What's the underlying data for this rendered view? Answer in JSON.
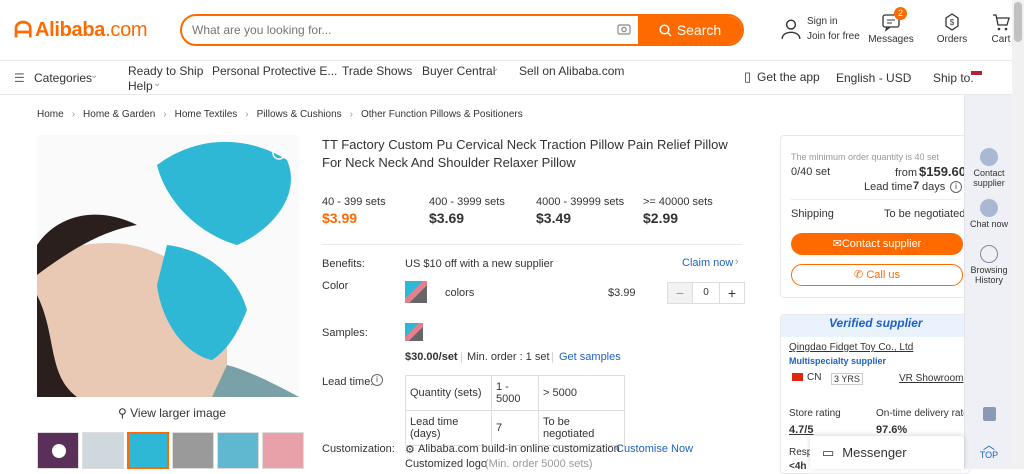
{
  "header": {
    "logo_text": "Alibaba",
    "logo_suffix": ".com",
    "search_placeholder": "What are you looking for...",
    "search_button": "Search",
    "sign_in": "Sign in",
    "join": "Join for free",
    "messages": "Messages",
    "messages_badge": "2",
    "orders": "Orders",
    "cart": "Cart"
  },
  "nav": {
    "categories": "Categories",
    "ready_to_ship": "Ready to Ship",
    "ppe": "Personal Protective E...",
    "trade_shows": "Trade Shows",
    "buyer_central": "Buyer Central",
    "sell": "Sell on Alibaba.com",
    "help": "Help",
    "get_app": "Get the app",
    "language": "English - USD",
    "ship_to": "Ship to:"
  },
  "breadcrumb": [
    "Home",
    "Home & Garden",
    "Home Textiles",
    "Pillows & Cushions",
    "Other Function Pillows & Positioners"
  ],
  "product": {
    "title": "TT Factory Custom Pu Cervical Neck Traction Pillow Pain Relief Pillow For Neck Neck And Shoulder Relaxer Pillow",
    "view_larger": "View larger image",
    "tiers": [
      {
        "qty": "40 - 399 sets",
        "price": "$3.99"
      },
      {
        "qty": "400 - 3999 sets",
        "price": "$3.69"
      },
      {
        "qty": "4000 - 39999 sets",
        "price": "$3.49"
      },
      {
        "qty": ">= 40000 sets",
        "price": "$2.99"
      }
    ],
    "benefits_label": "Benefits:",
    "benefits_text": "US $10 off with a new supplier",
    "claim_now": "Claim now",
    "color_label": "Color",
    "color_name": "colors",
    "color_price": "$3.99",
    "qty_value": "0",
    "samples_label": "Samples:",
    "sample_price": "$30.00/set",
    "sample_min": "Min. order : 1 set",
    "get_samples": "Get samples",
    "lead_label": "Lead time:",
    "lead_table": {
      "h1": "Quantity (sets)",
      "h2": "1 - 5000",
      "h3": "> 5000",
      "r1": "Lead time (days)",
      "r2": "7",
      "r3": "To be negotiated"
    },
    "custom_label": "Customization:",
    "custom_text": "Alibaba.com build-in online customization",
    "customise_now": "Customise Now",
    "custom_logo": "Customized logo",
    "custom_logo_min": "(Min. order 5000 sets)"
  },
  "order_panel": {
    "min_text": "The minimum order quantity is 40 set",
    "count": "0/40 set",
    "from": "from",
    "price": "$159.60",
    "lead": "Lead time",
    "lead_days": "7",
    "lead_unit": "days",
    "shipping": "Shipping",
    "shipping_val": "To be negotiated",
    "contact": "Contact supplier",
    "call": "Call us"
  },
  "supplier": {
    "verified": "Verified supplier",
    "name": "Qingdao Fidget Toy Co., Ltd",
    "type": "Multispecialty supplier",
    "country": "CN",
    "years": "3",
    "years_unit": "YRS",
    "showroom": "VR Showroom",
    "rating_label": "Store rating",
    "rating": "4.7/5",
    "ontime_label": "On-time delivery rate",
    "ontime": "97.6%",
    "resp": "Resp",
    "resp_val": "<4h"
  },
  "sidebar": {
    "contact": "Contact supplier",
    "chat": "Chat now",
    "history": "Browsing History",
    "top": "TOP"
  },
  "messenger": "Messenger",
  "colors": {
    "accent": "#ff6a00",
    "link": "#1d62c3"
  }
}
